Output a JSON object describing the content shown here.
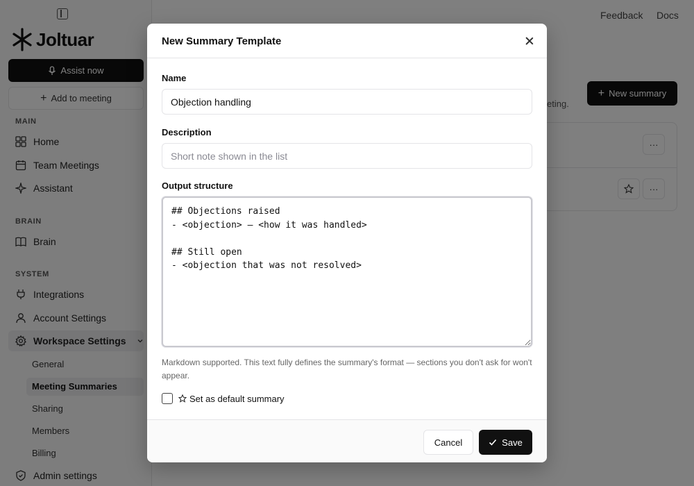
{
  "app": {
    "logo_text": "Joltuar",
    "assist_button": "Assist now",
    "add_meeting_button": "Add to meeting"
  },
  "topbar": {
    "feedback": "Feedback",
    "docs": "Docs"
  },
  "sidebar": {
    "sections": {
      "main": "MAIN",
      "brain": "BRAIN",
      "system": "SYSTEM"
    },
    "items": {
      "home": "Home",
      "team_meetings": "Team Meetings",
      "assistant": "Assistant",
      "brain": "Brain",
      "integrations": "Integrations",
      "account_settings": "Account Settings",
      "workspace_settings": "Workspace Settings",
      "admin_settings": "Admin settings"
    },
    "workspace_sub": [
      "General",
      "Meeting Summaries",
      "Sharing",
      "Members",
      "Billing"
    ]
  },
  "background": {
    "new_summary_button": "New summary",
    "subtitle_fragment": "eting."
  },
  "modal": {
    "title": "New Summary Template",
    "name_label": "Name",
    "name_value": "Objection handling",
    "description_label": "Description",
    "description_placeholder": "Short note shown in the list",
    "output_label": "Output structure",
    "output_value": "## Objections raised\n- <objection> — <how it was handled>\n\n## Still open\n- <objection that was not resolved>",
    "help_text": "Markdown supported. This text fully defines the summary's format — sections you don't ask for won't appear.",
    "default_label": "Set as default summary",
    "cancel_label": "Cancel",
    "save_label": "Save"
  },
  "colors": {
    "primary": "#111111",
    "overlay": "rgba(0,0,0,0.5)",
    "border": "#e4e4e7"
  }
}
